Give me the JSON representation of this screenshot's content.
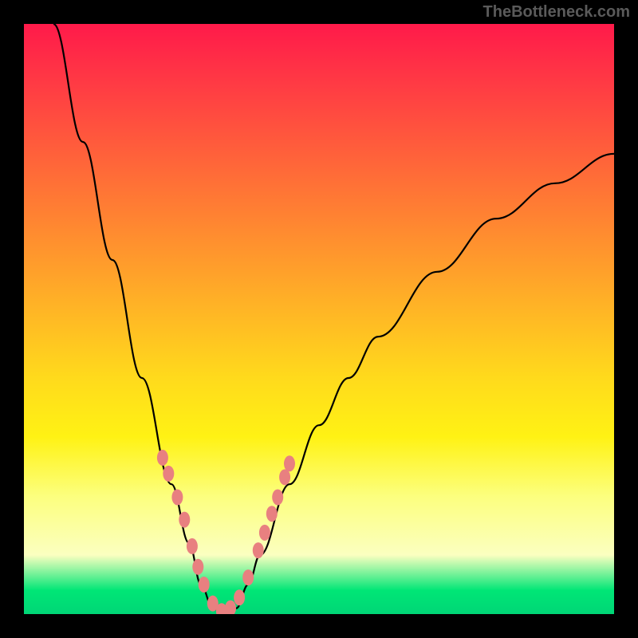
{
  "watermark": "TheBottleneck.com",
  "chart_data": {
    "type": "line",
    "title": "",
    "xlabel": "",
    "ylabel": "",
    "xlim": [
      0,
      1
    ],
    "ylim": [
      0,
      1
    ],
    "series": [
      {
        "name": "bottleneck-curve",
        "x": [
          0.05,
          0.1,
          0.15,
          0.2,
          0.25,
          0.28,
          0.3,
          0.32,
          0.34,
          0.36,
          0.38,
          0.4,
          0.45,
          0.5,
          0.55,
          0.6,
          0.7,
          0.8,
          0.9,
          1.0
        ],
        "y": [
          1.0,
          0.8,
          0.6,
          0.4,
          0.22,
          0.12,
          0.05,
          0.01,
          0.0,
          0.01,
          0.05,
          0.1,
          0.22,
          0.32,
          0.4,
          0.47,
          0.58,
          0.67,
          0.73,
          0.78
        ]
      }
    ],
    "highlight_points": {
      "name": "marked-points",
      "color": "#e88080",
      "x": [
        0.235,
        0.245,
        0.26,
        0.272,
        0.285,
        0.295,
        0.305,
        0.32,
        0.335,
        0.35,
        0.365,
        0.38,
        0.397,
        0.408,
        0.42,
        0.43,
        0.442,
        0.45
      ],
      "y": [
        0.265,
        0.238,
        0.198,
        0.16,
        0.115,
        0.08,
        0.05,
        0.018,
        0.005,
        0.01,
        0.028,
        0.062,
        0.108,
        0.138,
        0.17,
        0.198,
        0.232,
        0.255
      ]
    }
  }
}
